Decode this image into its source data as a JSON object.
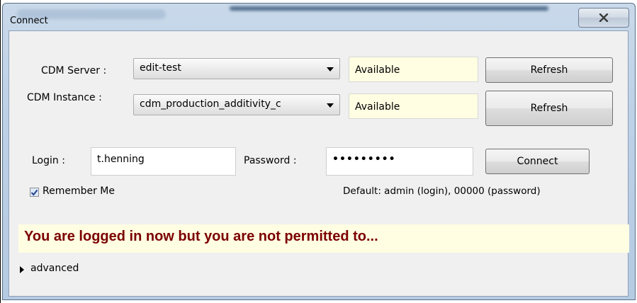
{
  "window": {
    "title": "Connect",
    "close_icon": "close-icon"
  },
  "server": {
    "label": "CDM Server :",
    "selected": "edit-test",
    "status": "Available",
    "refresh_label": "Refresh"
  },
  "instance": {
    "label": "CDM Instance :",
    "selected": "cdm_production_additivity_c",
    "status": "Available",
    "refresh_label": "Refresh"
  },
  "login": {
    "label": "Login :",
    "value": "t.henning",
    "password_label": "Password :",
    "password_value": "•••••••••",
    "connect_label": "Connect",
    "remember_label": "Remember Me",
    "remember_checked": true,
    "default_hint": "Default: admin (login), 00000 (password)"
  },
  "message": "You are logged in now but you are not permitted to...",
  "advanced": {
    "label": "advanced",
    "expanded": false
  },
  "colors": {
    "message_text": "#7b0000",
    "status_bg": "#fffde2",
    "titlebar": "#bcd0e6"
  }
}
